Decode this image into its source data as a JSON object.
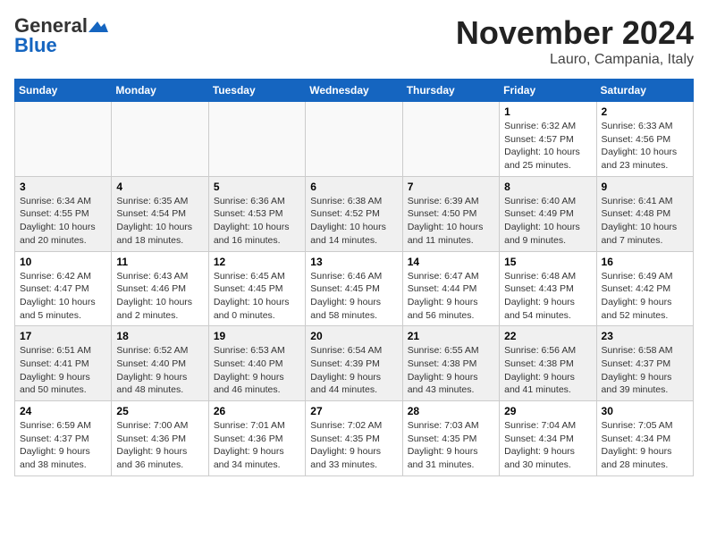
{
  "header": {
    "logo_general": "General",
    "logo_blue": "Blue",
    "month_title": "November 2024",
    "location": "Lauro, Campania, Italy"
  },
  "weekdays": [
    "Sunday",
    "Monday",
    "Tuesday",
    "Wednesday",
    "Thursday",
    "Friday",
    "Saturday"
  ],
  "weeks": [
    [
      {
        "day": "",
        "info": ""
      },
      {
        "day": "",
        "info": ""
      },
      {
        "day": "",
        "info": ""
      },
      {
        "day": "",
        "info": ""
      },
      {
        "day": "",
        "info": ""
      },
      {
        "day": "1",
        "info": "Sunrise: 6:32 AM\nSunset: 4:57 PM\nDaylight: 10 hours and 25 minutes."
      },
      {
        "day": "2",
        "info": "Sunrise: 6:33 AM\nSunset: 4:56 PM\nDaylight: 10 hours and 23 minutes."
      }
    ],
    [
      {
        "day": "3",
        "info": "Sunrise: 6:34 AM\nSunset: 4:55 PM\nDaylight: 10 hours and 20 minutes."
      },
      {
        "day": "4",
        "info": "Sunrise: 6:35 AM\nSunset: 4:54 PM\nDaylight: 10 hours and 18 minutes."
      },
      {
        "day": "5",
        "info": "Sunrise: 6:36 AM\nSunset: 4:53 PM\nDaylight: 10 hours and 16 minutes."
      },
      {
        "day": "6",
        "info": "Sunrise: 6:38 AM\nSunset: 4:52 PM\nDaylight: 10 hours and 14 minutes."
      },
      {
        "day": "7",
        "info": "Sunrise: 6:39 AM\nSunset: 4:50 PM\nDaylight: 10 hours and 11 minutes."
      },
      {
        "day": "8",
        "info": "Sunrise: 6:40 AM\nSunset: 4:49 PM\nDaylight: 10 hours and 9 minutes."
      },
      {
        "day": "9",
        "info": "Sunrise: 6:41 AM\nSunset: 4:48 PM\nDaylight: 10 hours and 7 minutes."
      }
    ],
    [
      {
        "day": "10",
        "info": "Sunrise: 6:42 AM\nSunset: 4:47 PM\nDaylight: 10 hours and 5 minutes."
      },
      {
        "day": "11",
        "info": "Sunrise: 6:43 AM\nSunset: 4:46 PM\nDaylight: 10 hours and 2 minutes."
      },
      {
        "day": "12",
        "info": "Sunrise: 6:45 AM\nSunset: 4:45 PM\nDaylight: 10 hours and 0 minutes."
      },
      {
        "day": "13",
        "info": "Sunrise: 6:46 AM\nSunset: 4:45 PM\nDaylight: 9 hours and 58 minutes."
      },
      {
        "day": "14",
        "info": "Sunrise: 6:47 AM\nSunset: 4:44 PM\nDaylight: 9 hours and 56 minutes."
      },
      {
        "day": "15",
        "info": "Sunrise: 6:48 AM\nSunset: 4:43 PM\nDaylight: 9 hours and 54 minutes."
      },
      {
        "day": "16",
        "info": "Sunrise: 6:49 AM\nSunset: 4:42 PM\nDaylight: 9 hours and 52 minutes."
      }
    ],
    [
      {
        "day": "17",
        "info": "Sunrise: 6:51 AM\nSunset: 4:41 PM\nDaylight: 9 hours and 50 minutes."
      },
      {
        "day": "18",
        "info": "Sunrise: 6:52 AM\nSunset: 4:40 PM\nDaylight: 9 hours and 48 minutes."
      },
      {
        "day": "19",
        "info": "Sunrise: 6:53 AM\nSunset: 4:40 PM\nDaylight: 9 hours and 46 minutes."
      },
      {
        "day": "20",
        "info": "Sunrise: 6:54 AM\nSunset: 4:39 PM\nDaylight: 9 hours and 44 minutes."
      },
      {
        "day": "21",
        "info": "Sunrise: 6:55 AM\nSunset: 4:38 PM\nDaylight: 9 hours and 43 minutes."
      },
      {
        "day": "22",
        "info": "Sunrise: 6:56 AM\nSunset: 4:38 PM\nDaylight: 9 hours and 41 minutes."
      },
      {
        "day": "23",
        "info": "Sunrise: 6:58 AM\nSunset: 4:37 PM\nDaylight: 9 hours and 39 minutes."
      }
    ],
    [
      {
        "day": "24",
        "info": "Sunrise: 6:59 AM\nSunset: 4:37 PM\nDaylight: 9 hours and 38 minutes."
      },
      {
        "day": "25",
        "info": "Sunrise: 7:00 AM\nSunset: 4:36 PM\nDaylight: 9 hours and 36 minutes."
      },
      {
        "day": "26",
        "info": "Sunrise: 7:01 AM\nSunset: 4:36 PM\nDaylight: 9 hours and 34 minutes."
      },
      {
        "day": "27",
        "info": "Sunrise: 7:02 AM\nSunset: 4:35 PM\nDaylight: 9 hours and 33 minutes."
      },
      {
        "day": "28",
        "info": "Sunrise: 7:03 AM\nSunset: 4:35 PM\nDaylight: 9 hours and 31 minutes."
      },
      {
        "day": "29",
        "info": "Sunrise: 7:04 AM\nSunset: 4:34 PM\nDaylight: 9 hours and 30 minutes."
      },
      {
        "day": "30",
        "info": "Sunrise: 7:05 AM\nSunset: 4:34 PM\nDaylight: 9 hours and 28 minutes."
      }
    ]
  ]
}
